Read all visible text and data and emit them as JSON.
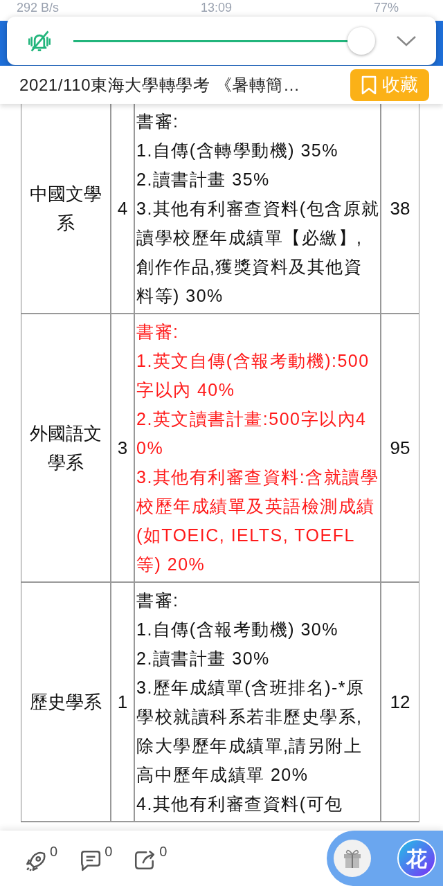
{
  "status_bar": {
    "speed": "292 B/s",
    "time": "13:09",
    "battery": "77%"
  },
  "volume_overlay": {
    "muted": true,
    "level": 1
  },
  "title": "2021/110東海大學轉學考 《暑轉簡…",
  "bookmark_button": "收藏",
  "table": {
    "rows": [
      {
        "department": "中國文學系",
        "quota": "4",
        "highlighted": false,
        "criteria": [
          "書審:",
          "1.自傳(含轉學動機) 35%",
          "2.讀書計畫 35%",
          "3.其他有利審查資料(包含原就讀學校歷年成績單【必繳】,創作作品,獲獎資料及其他資料等) 30%"
        ],
        "column_4": "38"
      },
      {
        "department": "外國語文學系",
        "quota": "3",
        "highlighted": true,
        "criteria": [
          "書審:",
          "1.英文自傳(含報考動機):500字以內 40%",
          "2.英文讀書計畫:500字以內40%",
          "3.其他有利審查資料:含就讀學校歷年成績單及英語檢測成績(如TOEIC, IELTS, TOEFL等) 20%"
        ],
        "column_4": "95"
      },
      {
        "department": "歷史學系",
        "quota": "1",
        "highlighted": false,
        "criteria": [
          "書審:",
          "1.自傳(含報考動機)  30%",
          "2.讀書計畫 30%",
          "3.歷年成績單(含班排名)-*原學校就讀科系若非歷史學系,除大學歷年成績單,請另附上高中歷年成績單 20%",
          "4.其他有利審查資料(可包"
        ],
        "column_4": "12"
      }
    ]
  },
  "bottom_bar": {
    "counts": [
      {
        "kind": "rocket",
        "count": "0"
      },
      {
        "kind": "comment",
        "count": "0"
      },
      {
        "kind": "share",
        "count": "0"
      }
    ],
    "logo_text": "花"
  }
}
